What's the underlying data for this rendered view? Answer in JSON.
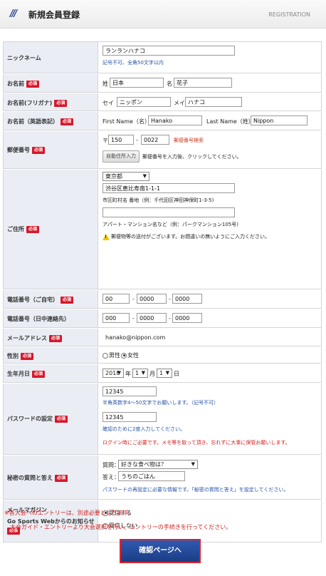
{
  "header": {
    "title": "新規会員登録",
    "subtitle": "REGISTRATION"
  },
  "required_label": "必須",
  "fields": {
    "nickname": {
      "label": "ニックネーム",
      "value": "ランランハナコ",
      "note": "記号不可、全角50文字以内"
    },
    "name": {
      "label": "お名前",
      "sei_label": "姓",
      "sei": "日本",
      "mei_label": "名",
      "mei": "花子"
    },
    "kana": {
      "label": "お名前(フリガナ)",
      "sei_label": "セイ",
      "sei": "ニッポン",
      "mei_label": "メイ",
      "mei": "ハナコ"
    },
    "roman": {
      "label": "お名前（英語表記）",
      "first_label": "First Name（名）",
      "first": "Hanako",
      "last_label": "Last Name（姓）",
      "last": "Nippon"
    },
    "postal": {
      "label": "郵便番号",
      "prefix": "〒",
      "part1": "150",
      "dash": "-",
      "part2": "0022",
      "search_link": "郵便番号検索",
      "auto_button": "自動住所入力",
      "auto_note": "郵便番号を入力後、クリックしてください。"
    },
    "address": {
      "label": "ご住所",
      "prefecture": "東京都",
      "line1": "渋谷区恵比寿南1-1-1",
      "line1_note": "市区町村名 番地（例：千代田区神田神保町1-3-5)",
      "line2": "",
      "line2_note": "アパート・マンション名など（例：パークマンション105号)",
      "warning": "郵便物等の送付がございます。お間違いの無いようにご入力ください。"
    },
    "phone_home": {
      "label": "電話番号（ご自宅）",
      "p1": "00",
      "p2": "0000",
      "p3": "0000"
    },
    "phone_day": {
      "label": "電話番号（日中連絡先）",
      "p1": "000",
      "p2": "0000",
      "p3": "0000"
    },
    "email": {
      "label": "メールアドレス",
      "value": "hanako@nippon.com"
    },
    "gender": {
      "label": "性別",
      "male": "男性",
      "female": "女性",
      "selected": "female"
    },
    "birth": {
      "label": "生年月日",
      "year": "2018",
      "year_unit": "年",
      "month": "1",
      "month_unit": "月",
      "day": "1",
      "day_unit": "日"
    },
    "password": {
      "label": "パスワードの設定",
      "value": "12345",
      "note1": "半角英数字4〜50文字でお願いします。（記号不可）",
      "confirm": "12345",
      "note2": "確認のために2度入力してください。",
      "note3": "ログイン時にご必要です。メモ等を取って頂き、忘れずに大事に保管お願いします。"
    },
    "secret": {
      "label": "秘密の質問と答え",
      "question_label": "質問：",
      "question": "好きな食べ物は？",
      "answer_label": "答え：",
      "answer": "うちのごはん",
      "note": "パスワードの再設定に必要な情報です。「秘密の質問と答え」を設定してください。"
    },
    "magazine": {
      "label1": "メールマガジン",
      "label2": "Go Sports Webからのお知らせ",
      "opt_in": "受信する",
      "opt_out": "受信しない",
      "selected": "opt_in"
    }
  },
  "footnote": {
    "line1": "※各大会へのエントリーは、別途必要となります。",
    "line2": "大会ガイド・エントリーより大会選択を行い、エントリーの手続きを行ってください。"
  },
  "confirm_button": "確認ページへ",
  "colors": {
    "required_badge": "#d7182a",
    "label_bg": "#eaeef4",
    "button_bg": "#1c3d86",
    "note_blue": "#2553a8",
    "note_red": "#d31d1d"
  }
}
